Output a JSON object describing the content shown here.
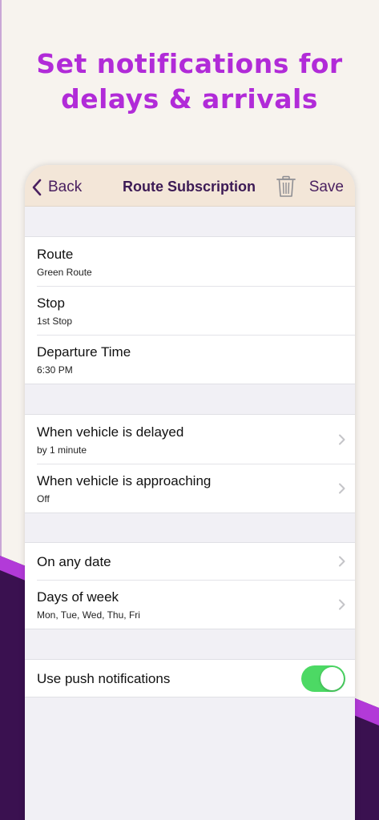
{
  "headline": {
    "line1": "Set notifications for",
    "line2": "delays & arrivals"
  },
  "navbar": {
    "back_label": "Back",
    "title": "Route Subscription",
    "save_label": "Save",
    "icons": {
      "back": "chevron-left-icon",
      "delete": "trash-icon"
    }
  },
  "details": [
    {
      "title": "Route",
      "value": "Green Route"
    },
    {
      "title": "Stop",
      "value": "1st Stop"
    },
    {
      "title": "Departure Time",
      "value": "6:30 PM"
    }
  ],
  "alerts": [
    {
      "title": "When vehicle is delayed",
      "value": "by 1 minute"
    },
    {
      "title": "When vehicle is approaching",
      "value": "Off"
    }
  ],
  "schedule": {
    "any_date_label": "On any date",
    "days_title": "Days of week",
    "days_value": "Mon, Tue, Wed, Thu, Fri"
  },
  "push": {
    "label": "Use push notifications",
    "enabled": true
  },
  "colors": {
    "accent_headline": "#b12bd8",
    "nav_background": "#f3e6d8",
    "nav_text": "#3c1a55",
    "toggle_on": "#4cd964",
    "background_purple": "#3a1150"
  }
}
